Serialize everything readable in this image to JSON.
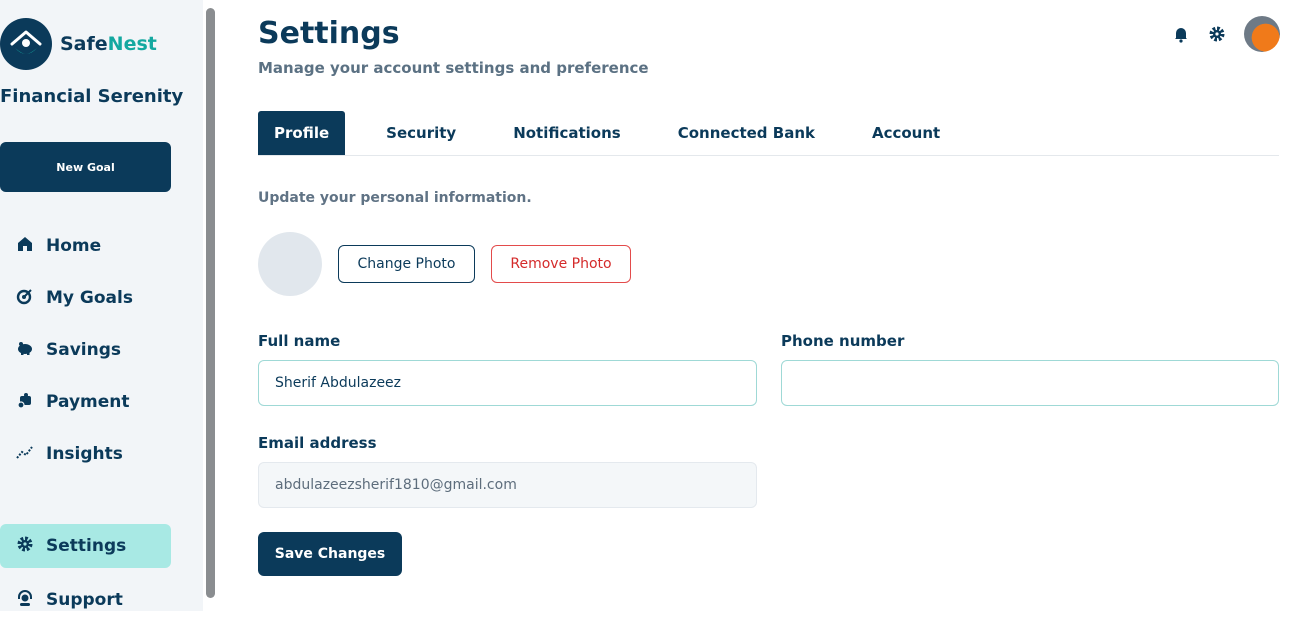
{
  "brand": {
    "name_part1": "Safe",
    "name_part2": "Nest",
    "tagline": "Financial Serenity"
  },
  "sidebar": {
    "new_goal_label": "New Goal",
    "items": [
      {
        "label": "Home",
        "icon": "home-icon"
      },
      {
        "label": "My Goals",
        "icon": "target-icon"
      },
      {
        "label": "Savings",
        "icon": "piggy-bank-icon"
      },
      {
        "label": "Payment",
        "icon": "payment-icon"
      },
      {
        "label": "Insights",
        "icon": "chart-line-icon"
      },
      {
        "label": "Settings",
        "icon": "gear-icon",
        "active": true
      },
      {
        "label": "Support",
        "icon": "headset-icon"
      }
    ]
  },
  "header": {
    "title": "Settings",
    "subtitle": "Manage your account settings and preference",
    "icons": [
      "bell-icon",
      "gear-icon",
      "avatar"
    ]
  },
  "tabs": [
    {
      "label": "Profile",
      "active": true
    },
    {
      "label": "Security"
    },
    {
      "label": "Notifications"
    },
    {
      "label": "Connected Bank"
    },
    {
      "label": "Account"
    }
  ],
  "profile": {
    "description": "Update your personal information.",
    "change_photo_label": "Change Photo",
    "remove_photo_label": "Remove Photo",
    "full_name_label": "Full name",
    "full_name_value": "Sherif Abdulazeez",
    "phone_label": "Phone number",
    "phone_value": "",
    "email_label": "Email address",
    "email_value": "abdulazeezsherif1810@gmail.com",
    "save_label": "Save Changes"
  },
  "colors": {
    "primary": "#0b3a5a",
    "accent": "#14a8a0",
    "active_nav": "#a8e9e4",
    "danger": "#d42a2a"
  }
}
